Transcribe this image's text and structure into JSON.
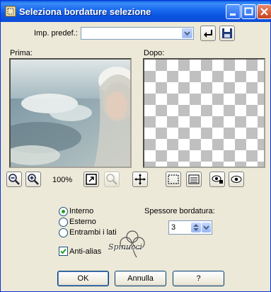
{
  "window": {
    "title": "Seleziona bordature selezione"
  },
  "preset": {
    "label": "Imp. predef.:",
    "value": ""
  },
  "preview": {
    "before_label": "Prima:",
    "after_label": "Dopo:",
    "zoom": "100%"
  },
  "options": {
    "radio_interno": "Interno",
    "radio_esterno": "Esterno",
    "radio_entrambi": "Entrambi i lati",
    "selected": "Interno",
    "antialias_label": "Anti-alias",
    "antialias_checked": true
  },
  "thickness": {
    "label": "Spessore bordatura:",
    "value": "3"
  },
  "watermark": {
    "text": "Spinucci"
  },
  "buttons": {
    "ok": "OK",
    "cancel": "Annulla",
    "help": "?"
  },
  "colors": {
    "titlebar": "#0a54e0",
    "face": "#ece9d8",
    "check_green": "#21a121"
  }
}
